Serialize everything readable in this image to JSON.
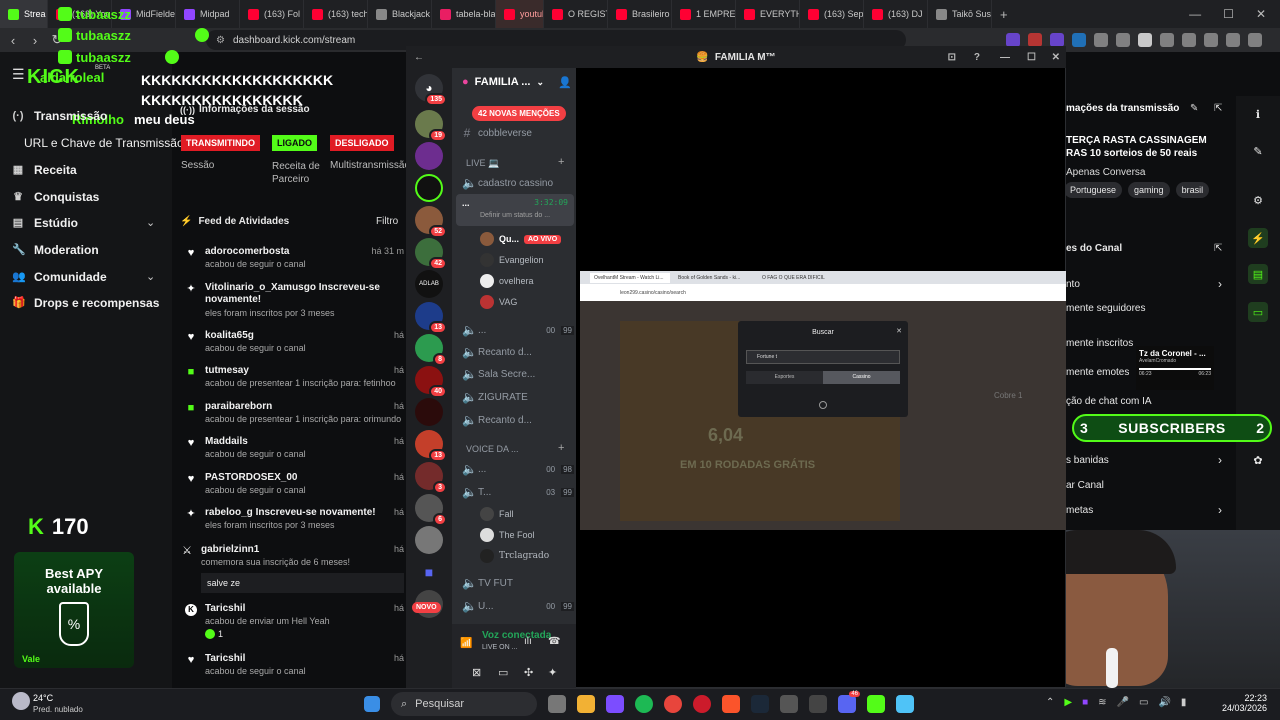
{
  "browser": {
    "tabs": [
      {
        "label": "Strea",
        "color": "#53fc18"
      },
      {
        "label": "(163) You",
        "color": "#ff0033"
      },
      {
        "label": "MidFielde",
        "color": "#9146ff"
      },
      {
        "label": "Midpad",
        "color": "#9146ff"
      },
      {
        "label": "(163) Fol",
        "color": "#ff0033"
      },
      {
        "label": "(163) tech",
        "color": "#ff0033"
      },
      {
        "label": "Blackjack",
        "color": "#888888"
      },
      {
        "label": "tabela-bla",
        "color": "#e91e63"
      },
      {
        "label": "youtube",
        "color": "#ff0033"
      },
      {
        "label": "O REGIST",
        "color": "#ff0033"
      },
      {
        "label": "Brasileiro",
        "color": "#ff0033"
      },
      {
        "label": "1 EMPRES",
        "color": "#ff0033"
      },
      {
        "label": "EVERYTHI",
        "color": "#ff0033"
      },
      {
        "label": "(163) Sep",
        "color": "#ff0033"
      },
      {
        "label": "(163) DJ",
        "color": "#ff0033"
      },
      {
        "label": "Taikō Sus",
        "color": "#888888"
      }
    ],
    "new_tab": "+",
    "url": "dashboard.kick.com/stream"
  },
  "chat_overlay": {
    "lines": [
      {
        "user": "tubaaszz",
        "text": ""
      },
      {
        "user": "tubaaszz",
        "text": ""
      },
      {
        "user": "tubaaszz",
        "text": ""
      },
      {
        "user": "aldairoleal",
        "text": "KKKKKKKKKKKKKKKKKKKKKKKKKKKKKKKKKKK"
      },
      {
        "user": "Rimolho",
        "text": "meu deus"
      }
    ]
  },
  "kick": {
    "logo": "KICK",
    "beta": "BETA",
    "nav": [
      {
        "label": "Transmissão",
        "icon": "broadcast-icon"
      },
      {
        "label": "URL e Chave de Transmissão",
        "icon": ""
      },
      {
        "label": "Receita",
        "icon": "receipt-icon"
      },
      {
        "label": "Conquistas",
        "icon": "trophy-icon"
      },
      {
        "label": "Estúdio",
        "icon": "studio-icon"
      },
      {
        "label": "Moderation",
        "icon": "wrench-icon"
      },
      {
        "label": "Comunidade",
        "icon": "people-icon"
      },
      {
        "label": "Drops e recompensas",
        "icon": "gift-icon"
      }
    ],
    "session_title": "Informações da sessão",
    "status": {
      "transmitindo": "TRANSMITINDO",
      "ligado": "LIGADO",
      "desligado": "DESLIGADO"
    },
    "status_labels": {
      "sessao": "Sessão",
      "receita": "Receita de Parceiro",
      "multi": "Multistransmissão"
    },
    "feed_title": "Feed de Atividades",
    "feed_filter": "Filtro",
    "feed": [
      {
        "name": "adorocomerbosta",
        "sub": "acabou de seguir o canal",
        "time": "há 31 m",
        "icon": "heart-icon"
      },
      {
        "name": "Vitolinario_o_Xamusgo Inscreveu-se novamente!",
        "sub": "eles foram inscritos por 3 meses",
        "time": "",
        "icon": "sparkle-icon"
      },
      {
        "name": "koalita65g",
        "sub": "acabou de seguir o canal",
        "time": "há",
        "icon": "heart-icon"
      },
      {
        "name": "tutmesay",
        "sub": "acabou de presentear 1 inscrição para: fetinhoo",
        "time": "há",
        "icon": "gift-icon"
      },
      {
        "name": "paraibareborn",
        "sub": "acabou de presentear 1 inscrição para: orimundo",
        "time": "há",
        "icon": "gift-icon"
      },
      {
        "name": "Maddails",
        "sub": "acabou de seguir o canal",
        "time": "há",
        "icon": "heart-icon"
      },
      {
        "name": "PASTORDOSEX_00",
        "sub": "acabou de seguir o canal",
        "time": "há",
        "icon": "heart-icon"
      },
      {
        "name": "rabeloo_g Inscreveu-se novamente!",
        "sub": "eles foram inscritos por 3 meses",
        "time": "há",
        "icon": "sparkle-icon"
      },
      {
        "name": "gabrielzinn1",
        "sub": "comemora sua inscrição de 6 meses!",
        "time": "há",
        "icon": "party-icon"
      },
      {
        "name": "Taricshil",
        "sub": "acabou de enviar um Hell Yeah",
        "time": "há",
        "icon": "kick-icon"
      },
      {
        "name": "Taricshil",
        "sub": "acabou de seguir o canal",
        "time": "há",
        "icon": "heart-icon"
      }
    ],
    "feed_message": "salve ze",
    "feed_count": "1",
    "kick_count": "170",
    "promo": {
      "line1": "Best APY",
      "line2": "available",
      "footer": "Vale"
    },
    "right": {
      "title": "mações da transmissão",
      "stream_title": "TERÇA RASTA CASSINAGEM RAS 10 sorteios de 50 reais",
      "category": "Apenas Conversa",
      "tags": [
        "Portuguese",
        "gaming",
        "brasil"
      ],
      "section2": "es do Canal",
      "rows": [
        "nto",
        "mente seguidores",
        "mente inscritos",
        "mente emotes",
        "ção de chat com IA",
        "s banidas",
        "ar Canal",
        "metas"
      ]
    },
    "subscribers": {
      "left": "3",
      "label": "SUBSCRIBERS",
      "right": "2"
    },
    "mini_player": {
      "title": "Tz da Coronel - ...",
      "sub": "AvelamCromado",
      "t1": "06:23",
      "t2": "06:23"
    }
  },
  "discord": {
    "window_title": "FAMILIA M™",
    "server_name": "FAMILIA ...",
    "mentions": "42 NOVAS MENÇÕES",
    "dm_badge": "135",
    "server_badges": [
      "19",
      "52",
      "42",
      "13",
      "8",
      "40",
      "13",
      "3",
      "6"
    ],
    "new_label": "NOVO",
    "channels": [
      {
        "name": "cobbleverse",
        "type": "text"
      },
      {
        "name": "cadastro cassino",
        "type": "voice"
      }
    ],
    "category_live": "LIVE 💻",
    "category_voice": "VOICE DA ...",
    "active_call": {
      "name": "...",
      "timer": "3:32:09",
      "status": "Definir um status do ..."
    },
    "call_users": [
      {
        "name": "Qu...",
        "badge": "AO VIVO"
      },
      {
        "name": "Evangelion",
        "badge": ""
      },
      {
        "name": "ovelhera",
        "badge": ""
      },
      {
        "name": "VAG",
        "badge": ""
      }
    ],
    "voice_channels": [
      {
        "name": "...",
        "a": "00",
        "b": "99"
      },
      {
        "name": "Recanto d...",
        "a": "",
        "b": ""
      },
      {
        "name": "Sala Secre...",
        "a": "",
        "b": ""
      },
      {
        "name": "ZIGURATE",
        "a": "",
        "b": ""
      },
      {
        "name": "Recanto d...",
        "a": "",
        "b": ""
      }
    ],
    "voice_channels2": [
      {
        "name": "...",
        "a": "00",
        "b": "98"
      },
      {
        "name": "T...",
        "a": "03",
        "b": "99"
      }
    ],
    "voice_users2": [
      "Fall",
      "The Fool",
      "Trclagrado"
    ],
    "voice_channels3": [
      {
        "name": "TV FUT",
        "a": "",
        "b": ""
      },
      {
        "name": "U...",
        "a": "00",
        "b": "99"
      }
    ],
    "voice_connected": "Voz conectada",
    "voice_sub": "LIVE ON ..."
  },
  "screenshare": {
    "tabs": [
      "OvelhantM Stream - Watch Li...",
      "Book of Golden Sands - ki...",
      "O FAG O QUE ERA DIFICIL"
    ],
    "url": "leon299.casino/casino/search",
    "modal_title": "Buscar",
    "search_value": "Fortune t",
    "tab_a": "Esportes",
    "tab_b": "Cassino",
    "game_value": "6,04",
    "game_sub": "EM 10 RODADAS GRÁTIS",
    "side_label": "Cobre 1"
  },
  "taskbar": {
    "weather_temp": "24°C",
    "weather_desc": "Pred. nublado",
    "search": "Pesquisar",
    "time": "22:23",
    "date": "24/03/2026",
    "notif_count": "46"
  }
}
